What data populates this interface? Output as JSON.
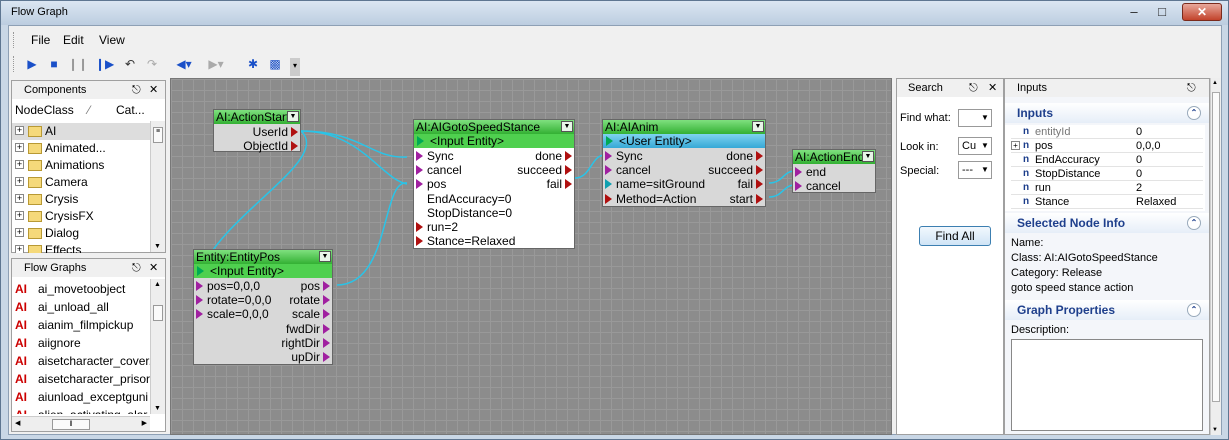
{
  "window": {
    "title": "Flow Graph"
  },
  "menu": {
    "file": "File",
    "edit": "Edit",
    "view": "View"
  },
  "components": {
    "title": "Components",
    "col1": "NodeClass",
    "col2": "Cat...",
    "items": [
      "AI",
      "Animated...",
      "Animations",
      "Camera",
      "Crysis",
      "CrysisFX",
      "Dialog",
      "Effects"
    ]
  },
  "flowgraphs": {
    "title": "Flow Graphs",
    "items": [
      "ai_movetoobject",
      "ai_unload_all",
      "aianim_filmpickup",
      "aiignore",
      "aisetcharacter_cover.",
      "aisetcharacter_prisor",
      "aiunload_exceptguni",
      "alien_activating_alar"
    ],
    "prefix": "AI"
  },
  "nodes": {
    "actionstart": {
      "title": "AI:ActionStart",
      "ports": [
        "UserId",
        "ObjectId"
      ]
    },
    "entitypos": {
      "title": "Entity:EntityPos",
      "entity": "<Input Entity>",
      "inputs": [
        "pos=0,0,0",
        "rotate=0,0,0",
        "scale=0,0,0"
      ],
      "outputs": [
        "pos",
        "rotate",
        "scale",
        "fwdDir",
        "rightDir",
        "upDir"
      ]
    },
    "gotospeed": {
      "title": "AI:AIGotoSpeedStance",
      "entity": "<Input Entity>",
      "inputs": [
        "Sync",
        "cancel",
        "pos",
        "EndAccuracy=0",
        "StopDistance=0",
        "run=2",
        "Stance=Relaxed"
      ],
      "outputs": [
        "done",
        "succeed",
        "fail"
      ]
    },
    "aianim": {
      "title": "AI:AIAnim",
      "entity": "<User Entity>",
      "inputs": [
        "Sync",
        "cancel",
        "name=sitGround",
        "Method=Action"
      ],
      "outputs": [
        "done",
        "succeed",
        "fail",
        "start"
      ]
    },
    "actionend": {
      "title": "AI:ActionEnd",
      "inputs": [
        "end",
        "cancel"
      ]
    }
  },
  "search": {
    "title": "Search",
    "find_what": "Find what:",
    "look_in": "Look in:",
    "look_in_value": "Cu",
    "special": "Special:",
    "special_value": "---",
    "find_all": "Find All"
  },
  "inputs_panel": {
    "title": "Inputs",
    "section": "Inputs",
    "props": [
      {
        "key": "entityId",
        "value": "0"
      },
      {
        "key": "pos",
        "value": "0,0,0"
      },
      {
        "key": "EndAccuracy",
        "value": "0"
      },
      {
        "key": "StopDistance",
        "value": "0"
      },
      {
        "key": "run",
        "value": "2"
      },
      {
        "key": "Stance",
        "value": "Relaxed"
      }
    ],
    "node_info_header": "Selected Node Info",
    "name_label": "Name:",
    "class_line": "Class: AI:AIGotoSpeedStance",
    "category_line": "Category: Release",
    "desc_line": "goto speed stance action",
    "graph_props_header": "Graph Properties",
    "description_label": "Description:"
  },
  "colors": {
    "link": "#29c4e8",
    "node_header": "#33b033",
    "entity_bar": "#4fd04f"
  }
}
